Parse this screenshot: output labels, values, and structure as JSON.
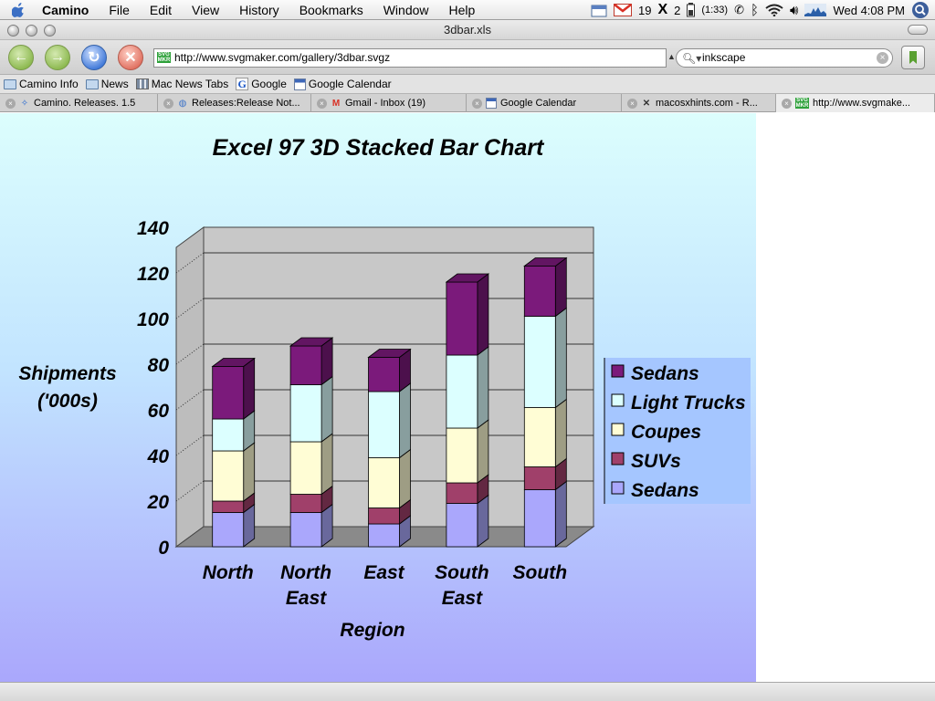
{
  "menubar": {
    "app_name": "Camino",
    "menus": [
      "File",
      "Edit",
      "View",
      "History",
      "Bookmarks",
      "Window",
      "Help"
    ],
    "gmail_count": "19",
    "x_count": "2",
    "battery_time": "(1:33)",
    "clock": "Wed 4:08 PM"
  },
  "window": {
    "title": "3dbar.xls"
  },
  "toolbar": {
    "url": "http://www.svgmaker.com/gallery/3dbar.svgz",
    "search_value": "inkscape"
  },
  "bookmarks": [
    {
      "label": "Camino Info",
      "icon": "folder-icon"
    },
    {
      "label": "News",
      "icon": "folder-icon"
    },
    {
      "label": "Mac News Tabs",
      "icon": "tabs-icon"
    },
    {
      "label": "Google",
      "icon": "google-icon"
    },
    {
      "label": "Google Calendar",
      "icon": "calendar-icon"
    }
  ],
  "tabs": [
    {
      "label": "Camino. Releases. 1.5",
      "icon": "camino-icon"
    },
    {
      "label": "Releases:Release Not...",
      "icon": "globe-icon"
    },
    {
      "label": "Gmail - Inbox (19)",
      "icon": "gmail-icon"
    },
    {
      "label": "Google Calendar",
      "icon": "calendar-icon"
    },
    {
      "label": "macosxhints.com - R...",
      "icon": "x-icon"
    },
    {
      "label": "http://www.svgmake...",
      "icon": "svg-icon",
      "active": true
    }
  ],
  "colors": {
    "sedans_top": "#7b1a7b",
    "light_trucks": "#dcffff",
    "coupes": "#fffdd5",
    "suvs": "#a0406a",
    "sedans_bottom": "#aaa7fc",
    "wall": "#c8c8c8",
    "floor": "#8a8a8a"
  },
  "chart_data": {
    "type": "bar",
    "stacked": true,
    "three_d": true,
    "title": "Excel 97 3D Stacked Bar Chart",
    "xlabel": "Region",
    "ylabel": "Shipments ('000s)",
    "ylabel_lines": [
      "Shipments",
      "('000s)"
    ],
    "categories": [
      "North",
      "North East",
      "East",
      "South East",
      "South"
    ],
    "category_lines": [
      [
        "North"
      ],
      [
        "North",
        "East"
      ],
      [
        "East"
      ],
      [
        "South",
        "East"
      ],
      [
        "South"
      ]
    ],
    "ylim": [
      0,
      140
    ],
    "yticks": [
      0,
      20,
      40,
      60,
      80,
      100,
      120,
      140
    ],
    "series": [
      {
        "name": "Sedans",
        "values": [
          15,
          15,
          10,
          19,
          25
        ],
        "color": "#aaa7fc"
      },
      {
        "name": "SUVs",
        "values": [
          5,
          8,
          7,
          9,
          10
        ],
        "color": "#a0406a"
      },
      {
        "name": "Coupes",
        "values": [
          22,
          23,
          22,
          24,
          26
        ],
        "color": "#fffdd5"
      },
      {
        "name": "Light Trucks",
        "values": [
          14,
          25,
          29,
          32,
          40
        ],
        "color": "#dcffff"
      },
      {
        "name": "Sedans",
        "values": [
          23,
          17,
          15,
          32,
          22
        ],
        "color": "#7b1a7b"
      }
    ],
    "legend_order": [
      "Sedans",
      "Light Trucks",
      "Coupes",
      "SUVs",
      "Sedans"
    ],
    "legend_position": "right"
  }
}
